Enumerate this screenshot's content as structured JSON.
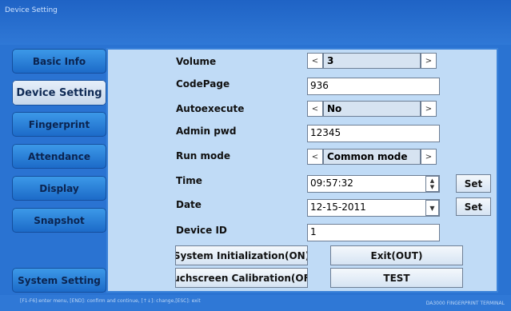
{
  "window": {
    "title": "Device Setting"
  },
  "nav": [
    "Basic Info",
    "Device Setting",
    "Fingerprint",
    "Attendance",
    "Display",
    "Snapshot",
    "System Setting"
  ],
  "form": {
    "volume": {
      "label": "Volume",
      "value": "3"
    },
    "codepage": {
      "label": "CodePage",
      "value": "936"
    },
    "autoexecute": {
      "label": "Autoexecute",
      "value": "No"
    },
    "admin_pwd": {
      "label": "Admin pwd",
      "value": "12345"
    },
    "run_mode": {
      "label": "Run mode",
      "value": "Common mode"
    },
    "time": {
      "label": "Time",
      "value": "09:57:32",
      "set": "Set"
    },
    "date": {
      "label": "Date",
      "value": "12-15-2011",
      "set": "Set"
    },
    "device_id": {
      "label": "Device ID",
      "value": "1"
    }
  },
  "buttons": {
    "system_init": "System Initialization(ON)",
    "exit": "Exit(OUT)",
    "touch_cal": "uchscreen Calibration(OF",
    "test": "TEST"
  },
  "arrows": {
    "left": "<",
    "right": ">"
  },
  "status": {
    "hint": "[F1-F6]:enter menu, [END]: confirm and continue, [↑↓]: change,[ESC]: exit",
    "brand": "DA3000 FINGERPRINT TERMINAL"
  }
}
